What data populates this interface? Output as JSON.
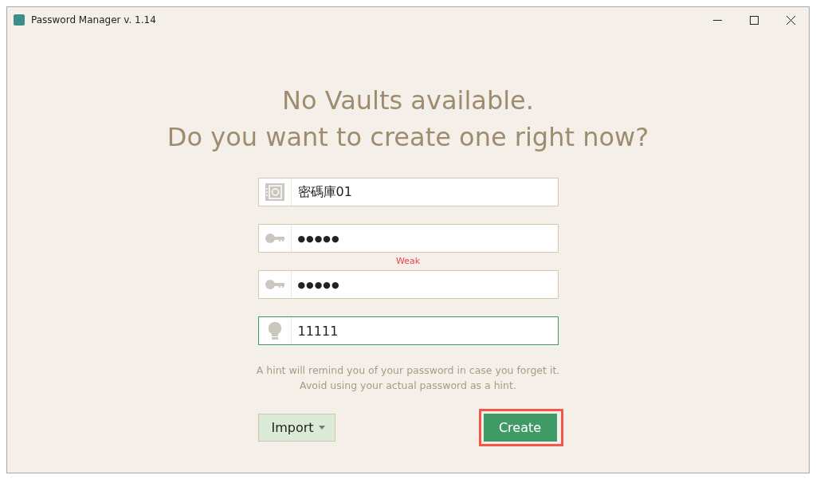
{
  "window": {
    "title": "Password Manager v. 1.14"
  },
  "heading": [
    "No Vaults available.",
    "Do you want to create one right now?"
  ],
  "fields": [
    {
      "kind": "vault",
      "value": "密碼庫01",
      "focused": false
    },
    {
      "kind": "password",
      "value": "●●●●●",
      "focused": false,
      "strength": "Weak"
    },
    {
      "kind": "password",
      "value": "●●●●●",
      "focused": false
    },
    {
      "kind": "hint",
      "value": "11111",
      "focused": true
    }
  ],
  "note": [
    "A hint will remind you of your password in case you forget it.",
    "Avoid using your actual password as a hint."
  ],
  "import_button": {
    "label": "Import"
  },
  "create_button": {
    "label": "Create",
    "highlighted": true
  }
}
